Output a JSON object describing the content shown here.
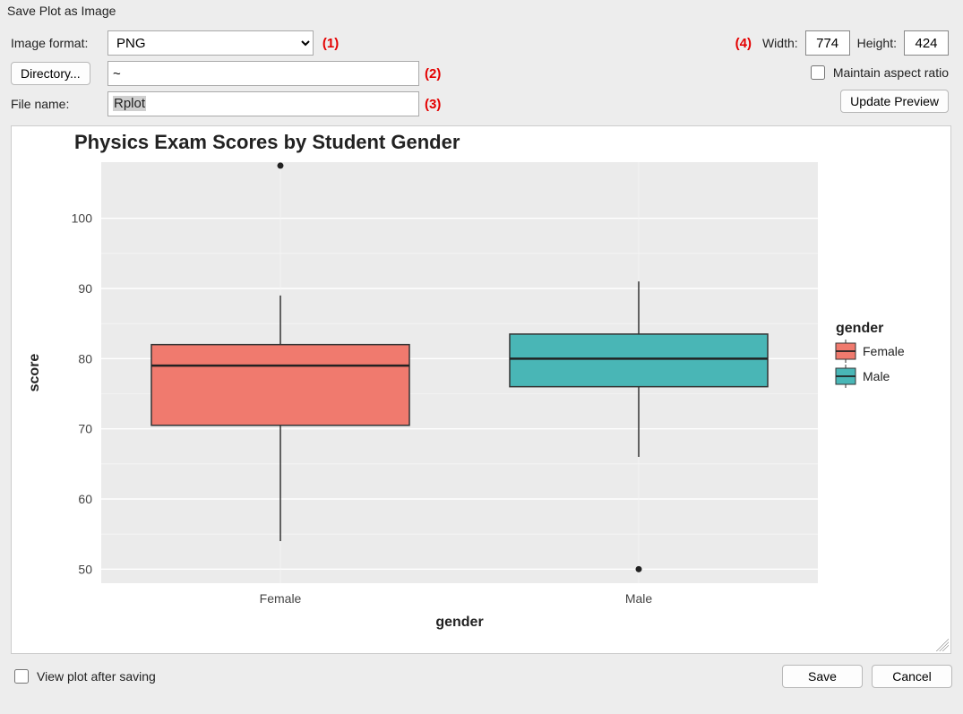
{
  "window_title": "Save Plot as Image",
  "labels": {
    "image_format": "Image format:",
    "directory_btn": "Directory...",
    "file_name": "File name:",
    "width": "Width:",
    "height": "Height:",
    "maintain_aspect": "Maintain aspect ratio",
    "update_preview": "Update Preview",
    "view_after": "View plot after saving",
    "save": "Save",
    "cancel": "Cancel"
  },
  "markers": {
    "m1": "(1)",
    "m2": "(2)",
    "m3": "(3)",
    "m4": "(4)"
  },
  "values": {
    "format_selected": "PNG",
    "directory": "~",
    "file_name": "Rplot",
    "width": "774",
    "height": "424",
    "maintain_aspect_checked": false,
    "view_after_checked": false
  },
  "chart_data": {
    "type": "boxplot",
    "title": "Physics Exam Scores by Student Gender",
    "xlabel": "gender",
    "ylabel": "score",
    "categories": [
      "Female",
      "Male"
    ],
    "y_ticks": [
      50,
      60,
      70,
      80,
      90,
      100
    ],
    "ylim": [
      48,
      108
    ],
    "legend_title": "gender",
    "legend_entries": [
      "Female",
      "Male"
    ],
    "colors": {
      "Female": "#f07a6e",
      "Male": "#49b6b6"
    },
    "series": [
      {
        "name": "Female",
        "lower_whisker": 54,
        "q1": 70.5,
        "median": 79,
        "q3": 82,
        "upper_whisker": 89,
        "outliers": [
          107.5
        ]
      },
      {
        "name": "Male",
        "lower_whisker": 66,
        "q1": 76,
        "median": 80,
        "q3": 83.5,
        "upper_whisker": 91,
        "outliers": [
          50
        ]
      }
    ]
  }
}
